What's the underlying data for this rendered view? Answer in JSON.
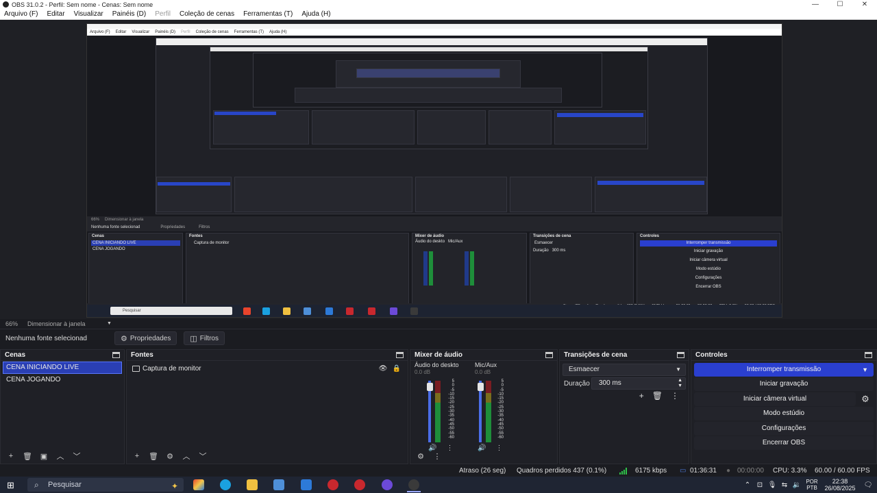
{
  "window": {
    "title": "OBS 31.0.2 - Perfil: Sem nome - Cenas: Sem nome"
  },
  "menu": [
    {
      "label": "Arquivo (F)",
      "enabled": true
    },
    {
      "label": "Editar",
      "enabled": true
    },
    {
      "label": "Visualizar",
      "enabled": true
    },
    {
      "label": "Painéis (D)",
      "enabled": true
    },
    {
      "label": "Perfil",
      "enabled": false
    },
    {
      "label": "Coleção de cenas",
      "enabled": true
    },
    {
      "label": "Ferramentas (T)",
      "enabled": true
    },
    {
      "label": "Ajuda (H)",
      "enabled": true
    }
  ],
  "preview": {
    "zoom": "66%",
    "resize_label": "Dimensionar à janela"
  },
  "source_toolbar": {
    "no_source": "Nenhuma fonte selecionad",
    "properties": "Propriedades",
    "filters": "Filtros"
  },
  "scenes": {
    "title": "Cenas",
    "items": [
      {
        "label": "CENA INICIANDO LIVE",
        "selected": true
      },
      {
        "label": "CENA JOGANDO",
        "selected": false
      }
    ]
  },
  "sources": {
    "title": "Fontes",
    "items": [
      {
        "label": "Captura de monitor"
      }
    ]
  },
  "mixer": {
    "title": "Mixer de áudio",
    "channels": [
      {
        "name": "Áudio do deskto",
        "db": "0.0 dB"
      },
      {
        "name": "Mic/Aux",
        "db": "0.0 dB"
      }
    ],
    "scale": [
      "5",
      "0",
      "-5",
      "-10",
      "-15",
      "-20",
      "-25",
      "-30",
      "-35",
      "-40",
      "-45",
      "-50",
      "-55",
      "-60"
    ]
  },
  "transitions": {
    "title": "Transições de cena",
    "selected": "Esmaecer",
    "duration_label": "Duração",
    "duration_value": "300 ms"
  },
  "controls": {
    "title": "Controles",
    "stop_stream": "Interromper transmissão",
    "start_recording": "Iniciar gravação",
    "start_virtual_cam": "Iniciar câmera virtual",
    "studio_mode": "Modo estúdio",
    "settings": "Configurações",
    "exit": "Encerrar OBS"
  },
  "status": {
    "delay": "Atraso (26 seg)",
    "dropped": "Quadros perdidos 437 (0.1%)",
    "bitrate": "6175 kbps",
    "stream_time": "01:36:31",
    "rec_time": "00:00:00",
    "cpu": "CPU: 3.3%",
    "fps": "60.00 / 60.00 FPS"
  },
  "taskbar": {
    "search_placeholder": "Pesquisar",
    "lang_top": "POR",
    "lang_bottom": "PTB",
    "time": "22:38",
    "date": "26/08/2025"
  },
  "colors": {
    "accent": "#2a3fcf",
    "selected_scene": "#2a3fb4",
    "meter_green": "#1e8e3a",
    "meter_red": "#7a1d22"
  }
}
